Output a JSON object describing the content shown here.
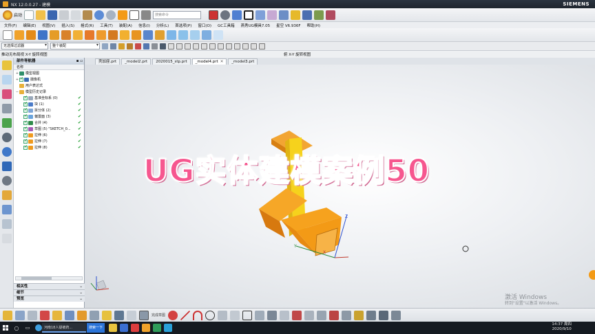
{
  "window": {
    "title": "NX 12.0.0.27 - 建模",
    "brand": "SIEMENS"
  },
  "toolbar_top": {
    "start_label": "启动",
    "search_placeholder": "搜索命令"
  },
  "menu": [
    "文件(F)",
    "编辑(E)",
    "视图(V)",
    "插入(S)",
    "格式(R)",
    "工具(T)",
    "装配(A)",
    "信息(I)",
    "分析(L)",
    "首选项(P)",
    "窗口(O)",
    "GC工具箱",
    "燕秀UG模具7.05",
    "星空 V6.936F",
    "帮助(H)"
  ],
  "selection_bar": {
    "filter_value": "无选择过滤器",
    "scope_value": "整个装配"
  },
  "view_labels": {
    "left": "推动无布局视 X-Y 旋转视图",
    "right": "俯 X-Y 旋转视图"
  },
  "navigator": {
    "title": "部件导航器",
    "column_name": "名称",
    "items": [
      {
        "label": "模型视图",
        "level": 0
      },
      {
        "label": "摄像机",
        "level": 0
      },
      {
        "label": "用户表达式",
        "level": 0
      },
      {
        "label": "模型历史记录",
        "level": 0
      },
      {
        "label": "基准坐标系 (0)",
        "level": 1
      },
      {
        "label": "块 (1)",
        "level": 1
      },
      {
        "label": "拆分体 (2)",
        "level": 1
      },
      {
        "label": "偏置面 (3)",
        "level": 1
      },
      {
        "label": "合并 (4)",
        "level": 1
      },
      {
        "label": "草图 (5) \"SKETCH_0...",
        "level": 1
      },
      {
        "label": "拉伸 (6)",
        "level": 1
      },
      {
        "label": "拉伸 (7)",
        "level": 1
      },
      {
        "label": "拉伸 (8)",
        "level": 1
      }
    ],
    "sections": [
      "相关性",
      "细节",
      "预览"
    ]
  },
  "tabs": [
    {
      "label": "壳加座.prt",
      "active": false
    },
    {
      "label": "_model2.prt",
      "active": false
    },
    {
      "label": "2020015_stp.prt",
      "active": false
    },
    {
      "label": "_model4.prt",
      "active": true
    },
    {
      "label": "_model3.prt",
      "active": false
    }
  ],
  "overlay_title": "UG实体建模案例50",
  "triad_labels": {
    "x": "X",
    "y": "Y",
    "z": "Z"
  },
  "sketch_toolbar_label": "完成草图",
  "activation": {
    "line1": "激活 Windows",
    "line2": "转到\"设置\"以激活 Windows。"
  },
  "taskbar": {
    "window_title": "河南18人疑被药...",
    "search_label": "搜索一下",
    "time": "14:37 周四",
    "date": "2020/9/10"
  },
  "colors": {
    "accent_pink": "#f6578f",
    "part_orange": "#f39a16",
    "part_yellow": "#f6d21c"
  }
}
